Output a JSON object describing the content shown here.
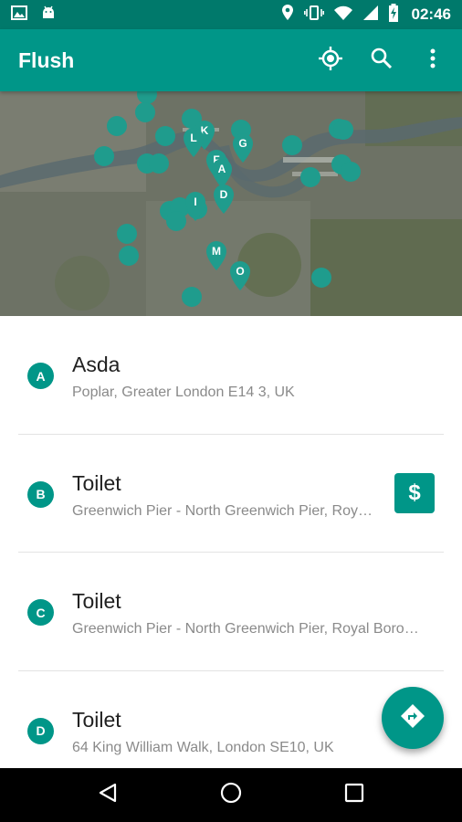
{
  "status_bar": {
    "time": "02:46",
    "left_icons": [
      "image-icon",
      "android-icon"
    ],
    "right_icons": [
      "location-icon",
      "vibrate-icon",
      "wifi-icon",
      "signal-icon",
      "battery-charging-icon"
    ]
  },
  "app_bar": {
    "title": "Flush",
    "actions": [
      "my-location-icon",
      "search-icon",
      "more-vert-icon"
    ]
  },
  "map": {
    "markers": [
      "A",
      "D",
      "F",
      "G",
      "I",
      "K",
      "L",
      "M",
      "O"
    ],
    "clusters": 24
  },
  "places": [
    {
      "letter": "A",
      "name": "Asda",
      "address": "Poplar, Greater London E14 3, UK",
      "paid": false
    },
    {
      "letter": "B",
      "name": "Toilet",
      "address": "Greenwich Pier - North Greenwich Pier, Royal Borough of Greenwich",
      "paid": true,
      "paid_symbol": "$"
    },
    {
      "letter": "C",
      "name": "Toilet",
      "address": "Greenwich Pier - North Greenwich Pier, Royal Borough of Greenwich",
      "paid": false
    },
    {
      "letter": "D",
      "name": "Toilet",
      "address": "64 King William Walk, London SE10, UK",
      "paid": false
    }
  ],
  "fab": {
    "icon": "directions-icon"
  },
  "nav_bar": {
    "buttons": [
      "back-icon",
      "home-icon",
      "recents-icon"
    ]
  },
  "colors": {
    "primary": "#009688",
    "primary_dark": "#00796b",
    "marker": "#1f9c8d"
  }
}
